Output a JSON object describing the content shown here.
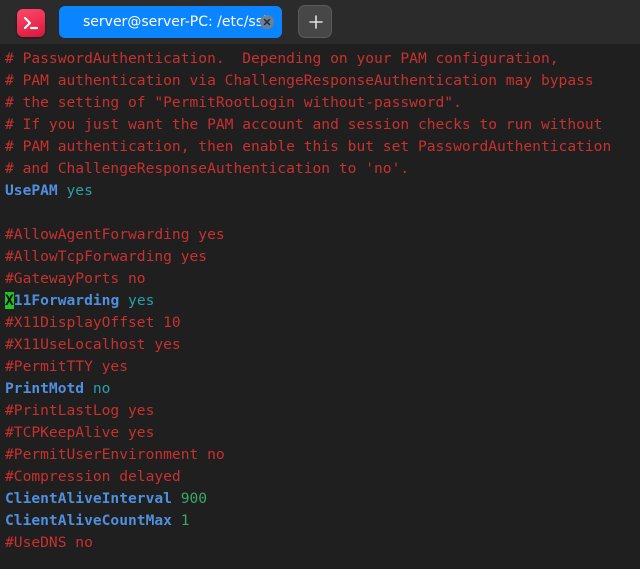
{
  "window": {
    "tab_title": "server@server-PC: /etc/ssh",
    "new_tab_symbol": "+",
    "app_icon": "terminal-icon"
  },
  "colors": {
    "tab_active": "#0a84ff",
    "comment": "#c8312f",
    "keyword": "#4f8fe0",
    "value": "#28a0a8",
    "number": "#3aa86a",
    "cursor": "#22c322",
    "background": "#1f1f1f"
  },
  "terminal": {
    "lines": [
      {
        "comment": "# PasswordAuthentication.  Depending on your PAM configuration,"
      },
      {
        "comment": "# PAM authentication via ChallengeResponseAuthentication may bypass"
      },
      {
        "comment": "# the setting of \"PermitRootLogin without-password\"."
      },
      {
        "comment": "# If you just want the PAM account and session checks to run without"
      },
      {
        "comment": "# PAM authentication, then enable this but set PasswordAuthentication"
      },
      {
        "comment": "# and ChallengeResponseAuthentication to 'no'."
      },
      {
        "keyword": "UsePAM",
        "value": "yes"
      },
      {
        "blank": ""
      },
      {
        "comment": "#AllowAgentForwarding yes"
      },
      {
        "comment": "#AllowTcpForwarding yes"
      },
      {
        "comment": "#GatewayPorts no"
      },
      {
        "cursor": "X",
        "keyword": "11Forwarding",
        "value": "yes"
      },
      {
        "comment": "#X11DisplayOffset 10"
      },
      {
        "comment": "#X11UseLocalhost yes"
      },
      {
        "comment": "#PermitTTY yes"
      },
      {
        "keyword": "PrintMotd",
        "value": "no"
      },
      {
        "comment": "#PrintLastLog yes"
      },
      {
        "comment": "#TCPKeepAlive yes"
      },
      {
        "comment": "#PermitUserEnvironment no"
      },
      {
        "comment": "#Compression delayed"
      },
      {
        "keyword": "ClientAliveInterval",
        "number": "900"
      },
      {
        "keyword": "ClientAliveCountMax",
        "number": "1"
      },
      {
        "comment": "#UseDNS no"
      }
    ]
  }
}
